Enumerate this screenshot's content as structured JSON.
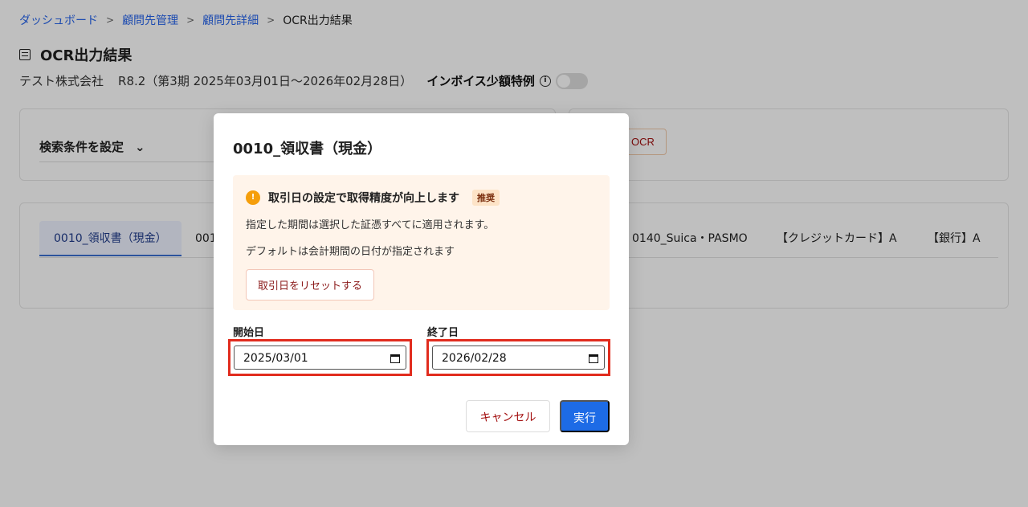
{
  "breadcrumb": [
    "ダッシュボード",
    "顧問先管理",
    "顧問先詳細",
    "OCR出力結果"
  ],
  "page": {
    "title": "OCR出力結果",
    "company": "テスト株式会社",
    "period": "R8.2（第3期 2025年03月01日〜2026年02月28日）",
    "invoice_label": "インボイス少額特例",
    "invoice_toggle": "off"
  },
  "search": {
    "label": "検索条件を設定"
  },
  "ocr_button": "OCR",
  "tabs": [
    {
      "label": "0010_領収書（現金）",
      "active": true
    },
    {
      "label": "001"
    },
    {
      "label": "0140_Suica・PASMO"
    },
    {
      "label": "【クレジットカード】A"
    },
    {
      "label": "【銀行】A"
    }
  ],
  "modal": {
    "title": "0010_領収書（現金）",
    "notice_heading": "取引日の設定で取得精度が向上します",
    "notice_badge": "推奨",
    "notice_line1": "指定した期間は選択した証憑すべてに適用されます。",
    "notice_line2": "デフォルトは会計期間の日付が指定されます",
    "reset_label": "取引日をリセットする",
    "start_label": "開始日",
    "start_value": "2025/03/01",
    "end_label": "終了日",
    "end_value": "2026/02/28",
    "cancel_label": "キャンセル",
    "execute_label": "実行"
  },
  "colors": {
    "accent": "#1d6be6",
    "link": "#2563eb",
    "highlight": "#e12c1e",
    "warn": "#f59e0b"
  }
}
